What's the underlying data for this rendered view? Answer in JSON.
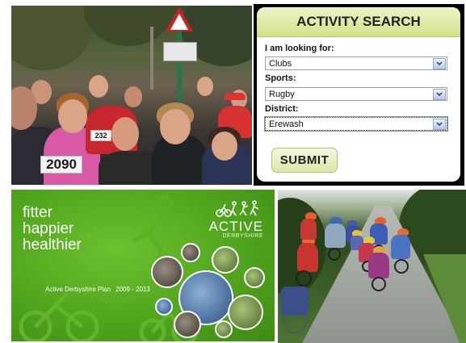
{
  "search": {
    "title": "ACTIVITY SEARCH",
    "looking_for_label": "I am looking for:",
    "looking_for_value": "Clubs",
    "sports_label": "Sports:",
    "sports_value": "Rugby",
    "district_label": "District:",
    "district_value": "Erewash",
    "submit_label": "SUBMIT"
  },
  "runners_photo": {
    "bib_number_front": "2090",
    "bib_number_side": "232"
  },
  "plan_cover": {
    "tagline_1": "fitter",
    "tagline_2": "happier",
    "tagline_3": "healthier",
    "brand_word": "ACTIVE",
    "brand_sub": "DERBYSHIRE",
    "plan_title": "Active Derbyshire Plan",
    "plan_years": "2009 - 2013"
  },
  "colors": {
    "search_header": "#d5e08a",
    "plan_green": "#4ea21c",
    "sign_red": "#cc2222"
  }
}
